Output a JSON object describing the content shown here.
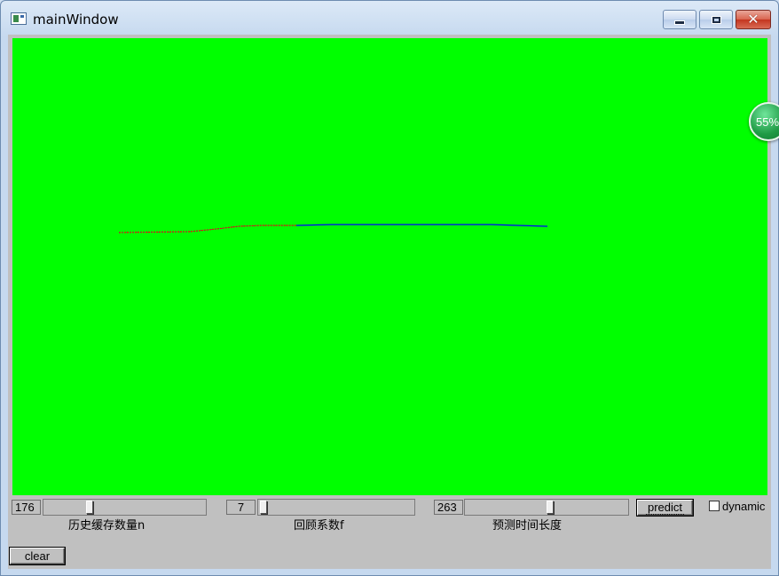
{
  "window": {
    "title": "mainWindow"
  },
  "controls": {
    "history": {
      "value": "176",
      "label": "历史缓存数量n",
      "slider_fraction": 0.29
    },
    "review": {
      "value": "7",
      "label": "回顾系数f",
      "slider_fraction": 0.0
    },
    "forecast": {
      "value": "263",
      "label": "预测时间长度",
      "slider_fraction": 0.52
    },
    "predict_label": "predict",
    "dynamic_label": "dynamic",
    "dynamic_checked": false,
    "clear_label": "clear"
  },
  "overlay": {
    "percent": "55%"
  },
  "colors": {
    "canvas_bg": "#00ff00",
    "history_line": "#ff0000",
    "forecast_line": "#0000ff"
  }
}
